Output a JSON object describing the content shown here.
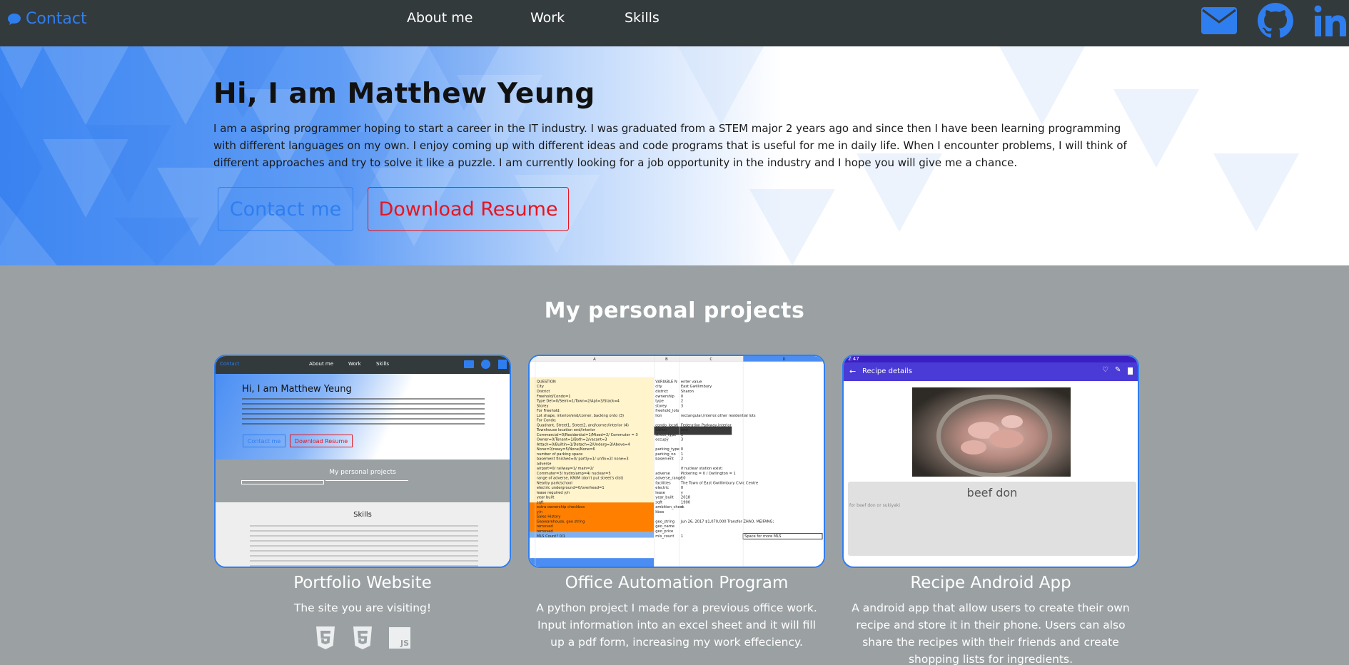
{
  "nav": {
    "contact_label": "Contact",
    "links": [
      "About me",
      "Work",
      "Skills"
    ],
    "social": [
      "envelope-icon",
      "github-icon",
      "linkedin-icon"
    ],
    "accent": "#2f7ef0",
    "bg": "#333a3c"
  },
  "hero": {
    "title": "Hi, I am Matthew Yeung",
    "intro": "I am a aspring programmer hoping to start a career in the IT industry. I was graduated from a STEM major 2 years ago and since then I have been learning programming with different languages on my own. I enjoy coming up with different ideas and code programs that is useful for me in daily life. When I encounter problems, I will think of different approaches and try to solve it like a puzzle. I am currently looking for a job opportunity in the industry and I hope you will give me a chance.",
    "contact_button": "Contact me",
    "resume_button": "Download Resume",
    "contact_color": "#2f7ef0",
    "resume_color": "#e8141e"
  },
  "projects": {
    "title": "My personal projects",
    "items": [
      {
        "title": "Portfolio Website",
        "desc": "The site you are visiting!",
        "tech": [
          "HTML5",
          "CSS3",
          "JS"
        ],
        "thumb": {
          "nav_links": [
            "About me",
            "Work",
            "Skills"
          ],
          "contact": "Contact",
          "title": "Hi, I am Matthew Yeung",
          "btn1": "Contact me",
          "btn2": "Download Resume",
          "section": "My personal projects",
          "skills": "Skills"
        }
      },
      {
        "title": "Office Automation Program",
        "desc": "A python project I made for a previous office work. Input information into an excel sheet and it will fill up a pdf form, increasing my work effeciency.",
        "thumb": {
          "col_headers": [
            "A",
            "B",
            "C",
            "D"
          ],
          "rows": [
            [
              "QUESTION",
              "VARIABLE N",
              "enter value"
            ],
            [
              "City",
              "city",
              "East Gwillimbury"
            ],
            [
              "District",
              "district",
              "Sharon"
            ],
            [
              "Freehold/Condo=1",
              "ownership",
              "0"
            ],
            [
              "Type Det=0/Semi=1/Town=2/Apt=3/Stack=4",
              "type",
              "2"
            ],
            [
              "Storey",
              "storey",
              "3"
            ],
            [
              "For Freehold:",
              "freehold_lots",
              ""
            ],
            [
              "Lot shape, interior/end/corner, backing onto (3)",
              "lion",
              "rectangular,interior,other residential lots"
            ],
            [
              "For Condo:",
              "",
              ""
            ],
            [
              "Quadrant, Street1, Street2, and/corner/interior (4)",
              "condo_locati",
              "Federation Parkway,interior"
            ],
            [
              "Townhouse location end/interior",
              "cation",
              "end"
            ],
            [
              "Commercial=0/Residential=1/Mixed=2/ Commuter = 3",
              "street_type",
              "1"
            ],
            [
              "Owner=0/Tenant=1/Both=2/vacant=3",
              "occupy",
              "3"
            ],
            [
              "Attach=0/Builtin=1/Detach=2/Underg=3/Above=4",
              "",
              ""
            ],
            [
              "None=0/nway=5/None/None=6",
              "parking_type",
              "0"
            ],
            [
              "number of parking space",
              "parking_no",
              "1"
            ],
            [
              "basement finished=0/ partly=1/ unfin=2/ none=3",
              "basement",
              "2"
            ],
            [
              "adverse",
              "",
              ""
            ],
            [
              "airport=0/ railway=1/ main=2/",
              "",
              "if nuclear station exist:"
            ],
            [
              "Commuter=3/ hydro/amp=4/ nuclear=5",
              "adverse",
              "Pickering = 0 / Darlington = 1"
            ],
            [
              "range of adverse, KM/M (don't put street's dist)",
              "adverse_range",
              "10"
            ],
            [
              "Nearby park/school",
              "facilities",
              "The Town of East Gwillimbury Civic Centre"
            ],
            [
              "electric underground=0/overhead=1",
              "electric",
              "0"
            ],
            [
              "lease required y/n",
              "lease",
              "y"
            ],
            [
              "year built",
              "year_built",
              "2018"
            ],
            [
              "sqft",
              "sqft",
              "1900"
            ],
            [
              "extra ownership checkbox",
              "ambition_check",
              "n"
            ],
            [
              "y/n",
              "kbos",
              ""
            ],
            [
              "Sales History",
              "",
              ""
            ],
            [
              "Geowarehouse, geo string",
              "geo_string",
              "Jun 26, 2017 $1,070,000 Transfer ZHAO, MEIFANG;"
            ],
            [
              "removed",
              "geo_name",
              ""
            ],
            [
              "removed",
              "geo_price",
              ""
            ],
            [
              "MLS Count? 0/1",
              "mls_count",
              "1",
              "Space for more MLS"
            ]
          ]
        }
      },
      {
        "title": "Recipe Android App",
        "desc": "A android app that allow users to create their own recipe and store it in their phone. Users can also share the recipes with their friends and create shopping lists for ingredients.",
        "thumb": {
          "bar_title": "Recipe details",
          "status_time": "2:47",
          "dish": "beef don",
          "note": "for beef don or sukiyaki"
        }
      }
    ]
  }
}
